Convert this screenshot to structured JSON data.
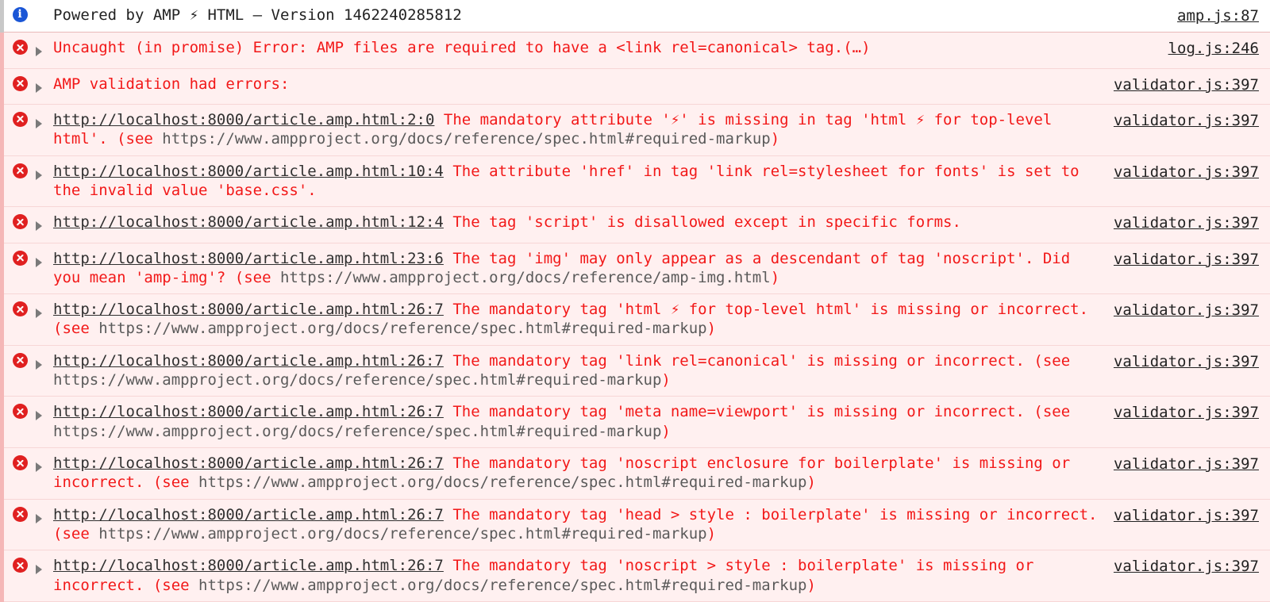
{
  "console": {
    "rows": [
      {
        "level": "info",
        "icon": "info-circle-icon",
        "expandable": false,
        "segments": [
          {
            "style": "black",
            "text": "Powered by AMP ⚡ HTML – Version 1462240285812"
          }
        ],
        "source": "amp.js:87"
      },
      {
        "level": "error",
        "icon": "error-circle-icon",
        "expandable": true,
        "segments": [
          {
            "style": "red",
            "text": "Uncaught (in promise) Error: AMP files are required to have a <link rel=canonical> tag.(…)"
          }
        ],
        "source": "log.js:246"
      },
      {
        "level": "error",
        "icon": "error-circle-icon",
        "expandable": true,
        "segments": [
          {
            "style": "red",
            "text": "AMP validation had errors:"
          }
        ],
        "source": "validator.js:397"
      },
      {
        "level": "error",
        "icon": "error-circle-icon",
        "expandable": true,
        "segments": [
          {
            "style": "link",
            "text": "http://localhost:8000/article.amp.html:2:0"
          },
          {
            "style": "red",
            "text": " The mandatory attribute '⚡' is missing in tag 'html ⚡ for top-level html'. (see "
          },
          {
            "style": "gray",
            "text": "https://www.ampproject.org/docs/reference/spec.html#required-markup"
          },
          {
            "style": "red",
            "text": ")"
          }
        ],
        "source": "validator.js:397"
      },
      {
        "level": "error",
        "icon": "error-circle-icon",
        "expandable": true,
        "segments": [
          {
            "style": "link",
            "text": "http://localhost:8000/article.amp.html:10:4"
          },
          {
            "style": "red",
            "text": " The attribute 'href' in tag 'link rel=stylesheet for fonts' is set to the invalid value 'base.css'."
          }
        ],
        "source": "validator.js:397"
      },
      {
        "level": "error",
        "icon": "error-circle-icon",
        "expandable": true,
        "segments": [
          {
            "style": "link",
            "text": "http://localhost:8000/article.amp.html:12:4"
          },
          {
            "style": "red",
            "text": " The tag 'script' is disallowed except in specific forms."
          }
        ],
        "source": "validator.js:397"
      },
      {
        "level": "error",
        "icon": "error-circle-icon",
        "expandable": true,
        "segments": [
          {
            "style": "link",
            "text": "http://localhost:8000/article.amp.html:23:6"
          },
          {
            "style": "red",
            "text": " The tag 'img' may only appear as a descendant of tag 'noscript'. Did you mean 'amp-img'? (see "
          },
          {
            "style": "gray",
            "text": "https://www.ampproject.org/docs/reference/amp-img.html"
          },
          {
            "style": "red",
            "text": ")"
          }
        ],
        "source": "validator.js:397"
      },
      {
        "level": "error",
        "icon": "error-circle-icon",
        "expandable": true,
        "segments": [
          {
            "style": "link",
            "text": "http://localhost:8000/article.amp.html:26:7"
          },
          {
            "style": "red",
            "text": " The mandatory tag 'html ⚡ for top-level html' is missing or incorrect. (see "
          },
          {
            "style": "gray",
            "text": "https://www.ampproject.org/docs/reference/spec.html#required-markup"
          },
          {
            "style": "red",
            "text": ")"
          }
        ],
        "source": "validator.js:397"
      },
      {
        "level": "error",
        "icon": "error-circle-icon",
        "expandable": true,
        "segments": [
          {
            "style": "link",
            "text": "http://localhost:8000/article.amp.html:26:7"
          },
          {
            "style": "red",
            "text": " The mandatory tag 'link rel=canonical' is missing or incorrect. (see "
          },
          {
            "style": "gray",
            "text": "https://www.ampproject.org/docs/reference/spec.html#required-markup"
          },
          {
            "style": "red",
            "text": ")"
          }
        ],
        "source": "validator.js:397"
      },
      {
        "level": "error",
        "icon": "error-circle-icon",
        "expandable": true,
        "segments": [
          {
            "style": "link",
            "text": "http://localhost:8000/article.amp.html:26:7"
          },
          {
            "style": "red",
            "text": " The mandatory tag 'meta name=viewport' is missing or incorrect. (see "
          },
          {
            "style": "gray",
            "text": "https://www.ampproject.org/docs/reference/spec.html#required-markup"
          },
          {
            "style": "red",
            "text": ")"
          }
        ],
        "source": "validator.js:397"
      },
      {
        "level": "error",
        "icon": "error-circle-icon",
        "expandable": true,
        "segments": [
          {
            "style": "link",
            "text": "http://localhost:8000/article.amp.html:26:7"
          },
          {
            "style": "red",
            "text": " The mandatory tag 'noscript enclosure for boilerplate' is missing or incorrect. (see "
          },
          {
            "style": "gray",
            "text": "https://www.ampproject.org/docs/reference/spec.html#required-markup"
          },
          {
            "style": "red",
            "text": ")"
          }
        ],
        "source": "validator.js:397"
      },
      {
        "level": "error",
        "icon": "error-circle-icon",
        "expandable": true,
        "segments": [
          {
            "style": "link",
            "text": "http://localhost:8000/article.amp.html:26:7"
          },
          {
            "style": "red",
            "text": " The mandatory tag 'head > style : boilerplate' is missing or incorrect. (see "
          },
          {
            "style": "gray",
            "text": "https://www.ampproject.org/docs/reference/spec.html#required-markup"
          },
          {
            "style": "red",
            "text": ")"
          }
        ],
        "source": "validator.js:397"
      },
      {
        "level": "error",
        "icon": "error-circle-icon",
        "expandable": true,
        "segments": [
          {
            "style": "link",
            "text": "http://localhost:8000/article.amp.html:26:7"
          },
          {
            "style": "red",
            "text": " The mandatory tag 'noscript > style : boilerplate' is missing or incorrect. (see "
          },
          {
            "style": "gray",
            "text": "https://www.ampproject.org/docs/reference/spec.html#required-markup"
          },
          {
            "style": "red",
            "text": ")"
          }
        ],
        "source": "validator.js:397"
      }
    ],
    "info_icon_glyph": "i",
    "colors": {
      "error_text": "#f21818",
      "error_row_bg": "#fff0f0",
      "error_icon": "#e02020",
      "info_icon": "#1a56d6",
      "url_text": "#5a5a5a"
    }
  }
}
